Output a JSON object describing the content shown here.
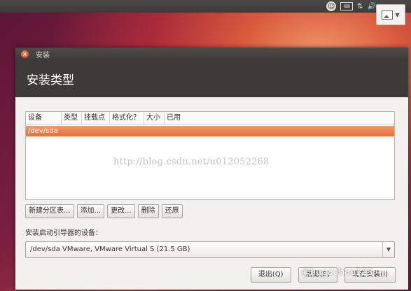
{
  "top_panel": {
    "icons": [
      "accessibility-icon",
      "keyboard-icon",
      "network-icon",
      "volume-icon"
    ],
    "overlay_icon": "image-icon"
  },
  "window": {
    "title": "安装",
    "header": "安装类型",
    "table": {
      "columns": [
        "设备",
        "类型",
        "挂载点",
        "格式化？",
        "大小",
        "已用"
      ],
      "rows": [
        {
          "device": "/dev/sda"
        }
      ]
    },
    "partition_buttons": [
      "新建分区表...",
      "添加...",
      "更改...",
      "删除",
      "还原"
    ],
    "boot_loader_label": "安装启动引导器的设备：",
    "boot_loader_value": "/dev/sda  VMware, VMware Virtual S (21.5 GB)",
    "bottom_buttons": [
      "退出(Q)",
      "后退(B)",
      "现在安装(I)"
    ]
  },
  "watermark": "http://blog.csdn.net/u012052268",
  "corner_watermark": "@hugaohao123",
  "colors": {
    "accent": "#e96d3c",
    "header_bg": "#3c3b37",
    "window_bg": "#f2f1f0"
  }
}
